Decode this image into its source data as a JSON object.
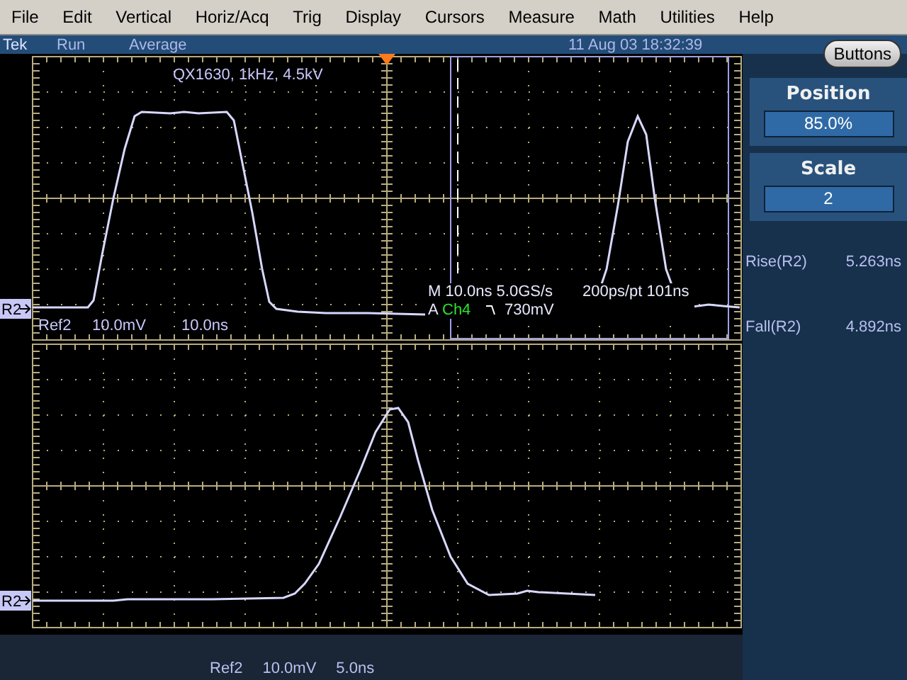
{
  "menu": [
    "File",
    "Edit",
    "Vertical",
    "Horiz/Acq",
    "Trig",
    "Display",
    "Cursors",
    "Measure",
    "Math",
    "Utilities",
    "Help"
  ],
  "status": {
    "brand": "Tek",
    "state": "Run",
    "mode": "Average",
    "datetime": "11 Aug 03 18:32:39"
  },
  "buttons_label": "Buttons",
  "upper_plot": {
    "title": "QX1630, 1kHz, 4.5kV",
    "marker": "R2",
    "readouts": [
      "Ref2",
      "10.0mV",
      "10.0ns"
    ],
    "timebase": "M 10.0ns 5.0GS/s",
    "record": "200ps/pt 101ns",
    "trigger": {
      "label": "A",
      "source": "Ch4",
      "threshold": "730mV"
    }
  },
  "lower_plot": {
    "marker": "R2",
    "readouts": [
      "Ref2",
      "10.0mV",
      "5.0ns"
    ]
  },
  "side_panel": {
    "controls": [
      {
        "label": "Position",
        "value": "85.0%"
      },
      {
        "label": "Scale",
        "value": "2"
      }
    ],
    "measurements": [
      {
        "label": "Rise(R2)",
        "value": "5.263ns"
      },
      {
        "label": "Fall(R2)",
        "value": "4.892ns"
      }
    ]
  }
}
